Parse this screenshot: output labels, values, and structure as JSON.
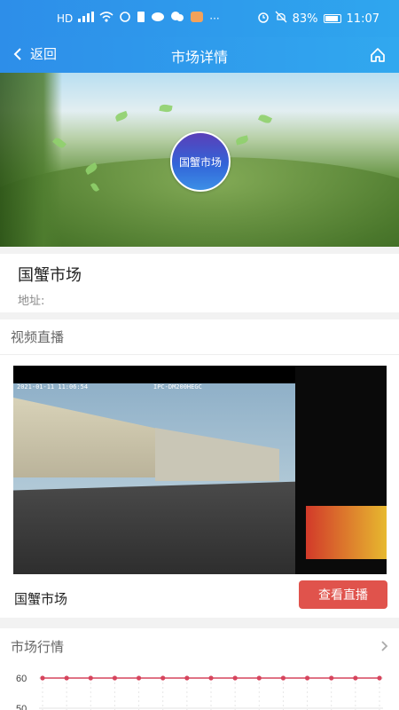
{
  "status_bar": {
    "left_text": "HD",
    "signal_label": "⁴⁶",
    "battery_pct": "83%",
    "time": "11:07",
    "icons": [
      "signal-icon",
      "wifi-icon",
      "sync-icon",
      "sim-icon",
      "message-icon",
      "chat-icon",
      "app-icon",
      "more-icon",
      "alarm-icon",
      "mute-icon",
      "battery-icon"
    ]
  },
  "nav": {
    "back_label": "返回",
    "title": "市场详情"
  },
  "hero": {
    "badge_text": "国蟹市场"
  },
  "market": {
    "name": "国蟹市场",
    "address_label": "地址:"
  },
  "video_section": {
    "heading": "视频直播",
    "timestamp_overlay": "2021-01-11 11:06:54",
    "camera_overlay": "IPC-DM200HEGC",
    "caption": "国蟹市场",
    "watch_button": "查看直播"
  },
  "market_section": {
    "heading": "市场行情"
  },
  "chart_data": {
    "type": "line",
    "y_tick_labels": [
      "60",
      "50"
    ],
    "series": [
      {
        "values": [
          60,
          60,
          60,
          60,
          60,
          60,
          60,
          60,
          60,
          60,
          60,
          60,
          60,
          60,
          60
        ],
        "color": "#d6455d"
      }
    ],
    "ylim": [
      50,
      60
    ],
    "grid": true
  },
  "colors": {
    "header_start": "#2d8ee9",
    "header_end": "#31a8ef",
    "button_red": "#e0534c",
    "series_line": "#d6455d"
  }
}
